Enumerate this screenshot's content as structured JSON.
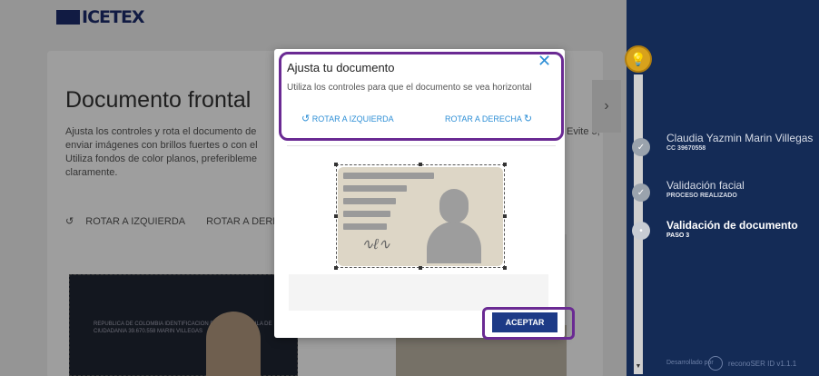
{
  "logo": {
    "text": "ICETEX"
  },
  "background": {
    "title": "Documento frontal",
    "instructions": "Ajusta los controles y rota el documento de enviar imágenes con brillos fuertes o con el Utiliza fondos de color planos, preferibleme claramente.",
    "instructions_right": "Evite o,",
    "rotate_left": "ROTAR A IZQUIERDA",
    "rotate_right": "ROTAR A DEREC",
    "doc_text": "REPUBLICA DE COLOMBIA IDENTIFICACION PERSONAL CEDULA DE CIUDADANIA 39.670.558 MARIN VILLEGAS"
  },
  "modal": {
    "title": "Ajusta tu documento",
    "subtitle": "Utiliza los controles para que el documento se vea horizontal",
    "rotate_left": "ROTAR A IZQUIERDA",
    "rotate_right": "ROTAR A DERECHA",
    "accept": "ACEPTAR",
    "close": "✕"
  },
  "sidebar": {
    "steps": [
      {
        "name": "Claudia Yazmin Marin Villegas",
        "sub": "CC 39670558",
        "status": "done"
      },
      {
        "name": "Validación facial",
        "sub": "PROCESO REALIZADO",
        "status": "done"
      },
      {
        "name": "Validación de documento",
        "sub": "PASO 3",
        "status": "active"
      }
    ],
    "footer_dev": "Desarrollado por",
    "footer_brand": "reconoSER ID v1.1.1"
  },
  "colors": {
    "accent": "#2e8fd6",
    "highlight": "#6a2a93",
    "primary": "#1d3a86",
    "sidebar": "#1b3a73"
  }
}
